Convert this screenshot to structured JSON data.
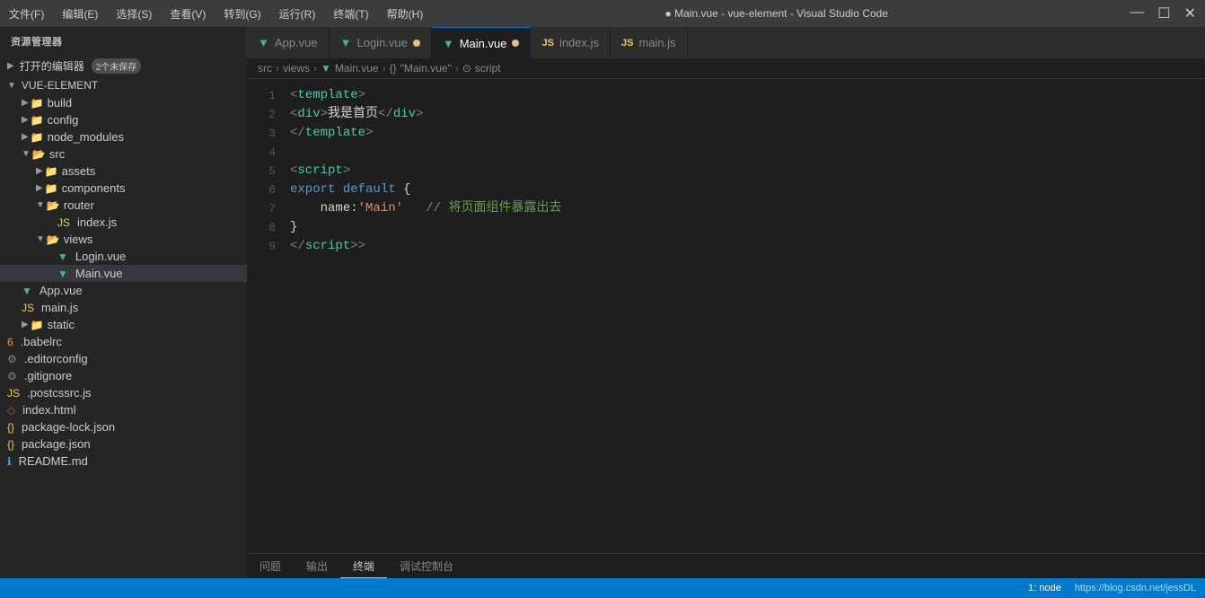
{
  "titlebar": {
    "menus": [
      "文件(F)",
      "编辑(E)",
      "选择(S)",
      "查看(V)",
      "转到(G)",
      "运行(R)",
      "终端(T)",
      "帮助(H)"
    ],
    "title": "● Main.vue - vue-element - Visual Studio Code",
    "controls": [
      "—",
      "☐",
      "✕"
    ]
  },
  "sidebar": {
    "title": "资源管理器",
    "open_editors_label": "打开的编辑器",
    "open_editors_badge": "2个未保存",
    "project_label": "VUE-ELEMENT",
    "tree": [
      {
        "id": "build",
        "label": "build",
        "type": "folder",
        "indent": 1,
        "expanded": false
      },
      {
        "id": "config",
        "label": "config",
        "type": "folder",
        "indent": 1,
        "expanded": false
      },
      {
        "id": "node_modules",
        "label": "node_modules",
        "type": "folder",
        "indent": 1,
        "expanded": false
      },
      {
        "id": "src",
        "label": "src",
        "type": "folder",
        "indent": 1,
        "expanded": true
      },
      {
        "id": "assets",
        "label": "assets",
        "type": "folder",
        "indent": 2,
        "expanded": false
      },
      {
        "id": "components",
        "label": "components",
        "type": "folder",
        "indent": 2,
        "expanded": false
      },
      {
        "id": "router",
        "label": "router",
        "type": "folder",
        "indent": 2,
        "expanded": true
      },
      {
        "id": "router-index",
        "label": "index.js",
        "type": "js",
        "indent": 3
      },
      {
        "id": "views",
        "label": "views",
        "type": "folder",
        "indent": 2,
        "expanded": true
      },
      {
        "id": "login-vue",
        "label": "Login.vue",
        "type": "vue",
        "indent": 3
      },
      {
        "id": "main-vue",
        "label": "Main.vue",
        "type": "vue",
        "indent": 3,
        "active": true
      },
      {
        "id": "app-vue",
        "label": "App.vue",
        "type": "vue",
        "indent": 1
      },
      {
        "id": "main-js",
        "label": "main.js",
        "type": "js",
        "indent": 1
      },
      {
        "id": "static",
        "label": "static",
        "type": "folder",
        "indent": 1,
        "expanded": false
      },
      {
        "id": "babelrc",
        "label": ".babelrc",
        "type": "config",
        "indent": 0
      },
      {
        "id": "editorconfig",
        "label": ".editorconfig",
        "type": "config",
        "indent": 0
      },
      {
        "id": "gitignore",
        "label": ".gitignore",
        "type": "config",
        "indent": 0
      },
      {
        "id": "postcssrc",
        "label": ".postcssrc.js",
        "type": "js",
        "indent": 0
      },
      {
        "id": "indexhtml",
        "label": "index.html",
        "type": "html",
        "indent": 0
      },
      {
        "id": "packagelock",
        "label": "package-lock.json",
        "type": "json",
        "indent": 0
      },
      {
        "id": "packagejson",
        "label": "package.json",
        "type": "json",
        "indent": 0
      },
      {
        "id": "readme",
        "label": "README.md",
        "type": "md",
        "indent": 0
      }
    ]
  },
  "tabs": [
    {
      "id": "app-vue-tab",
      "label": "App.vue",
      "type": "vue",
      "modified": false,
      "active": false
    },
    {
      "id": "login-vue-tab",
      "label": "Login.vue",
      "type": "vue",
      "modified": true,
      "active": false
    },
    {
      "id": "main-vue-tab",
      "label": "Main.vue",
      "type": "vue",
      "modified": true,
      "active": true
    },
    {
      "id": "index-js-tab",
      "label": "index.js",
      "type": "js",
      "modified": false,
      "active": false
    },
    {
      "id": "main-js-tab",
      "label": "main.js",
      "type": "js",
      "modified": false,
      "active": false
    }
  ],
  "breadcrumb": {
    "parts": [
      "src",
      ">",
      "views",
      ">",
      "Main.vue",
      ">",
      "{}",
      "\"Main.vue\"",
      ">",
      "⊙ script"
    ]
  },
  "code": {
    "lines": [
      {
        "num": 1,
        "html": "<span class='s-angle'>&lt;</span><span class='s-tag'>template</span><span class='s-angle'>&gt;</span>"
      },
      {
        "num": 2,
        "html": "    <span class='s-angle'>&lt;</span><span class='s-tag'>div</span><span class='s-angle'>&gt;</span><span class='s-white'>我是首页</span><span class='s-angle'>&lt;/</span><span class='s-tag'>div</span><span class='s-angle'>&gt;</span>"
      },
      {
        "num": 3,
        "html": "<span class='s-angle'>&lt;/</span><span class='s-tag'>template</span><span class='s-angle'>&gt;</span>"
      },
      {
        "num": 4,
        "html": ""
      },
      {
        "num": 5,
        "html": "<span class='s-angle'>&lt;</span><span class='s-tag'>script</span><span class='s-angle'>&gt;</span>"
      },
      {
        "num": 6,
        "html": "<span class='s-keyword'>export</span> <span class='s-keyword'>default</span> <span class='s-white'>{</span>"
      },
      {
        "num": 7,
        "html": "    <span class='s-white'>name:</span><span class='s-string'>'Main'</span>   <span class='s-comment'>// 将页面组件暴露出去</span>"
      },
      {
        "num": 8,
        "html": "<span class='s-white'>}</span>"
      },
      {
        "num": 9,
        "html": "<span class='s-angle'>&lt;/</span><span class='s-tag'>script</span><span class='s-angle'>&gt;</span><span class='s-angle'>&gt;</span>"
      }
    ]
  },
  "bottom_panel": {
    "tabs": [
      "问题",
      "输出",
      "终端",
      "调试控制台"
    ]
  },
  "status_bar": {
    "left": "",
    "right_items": [
      "1: node"
    ],
    "link": "https://blog.csdn.net/jessDL"
  }
}
